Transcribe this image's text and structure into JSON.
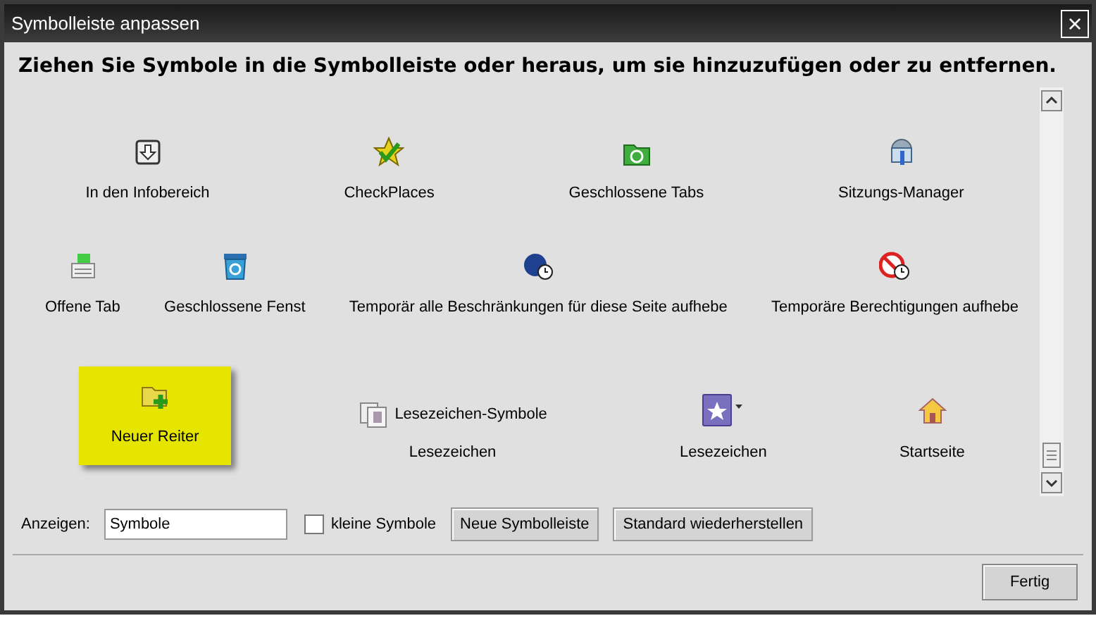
{
  "window": {
    "title": "Symbolleiste anpassen",
    "close": "×"
  },
  "instruction": "Ziehen Sie Symbole in die Symbolleiste oder heraus, um sie hinzuzufügen oder zu entfernen.",
  "rows": [
    [
      {
        "label": "In den Infobereich",
        "kind": "stacked",
        "selected": false
      },
      {
        "label": "CheckPlaces",
        "kind": "stacked",
        "selected": false
      },
      {
        "label": "Geschlossene Tabs",
        "kind": "stacked",
        "selected": false
      },
      {
        "label": "Sitzungs-Manager",
        "kind": "stacked",
        "selected": false
      }
    ],
    [
      {
        "label": "Offene Tab",
        "kind": "stacked",
        "selected": false
      },
      {
        "label": "Geschlossene Fenst",
        "kind": "stacked",
        "selected": false
      },
      {
        "label": "Temporär alle Beschränkungen für diese Seite aufhebe",
        "kind": "stacked",
        "selected": false
      },
      {
        "label": "Temporäre Berechtigungen aufhebe",
        "kind": "stacked",
        "selected": false
      }
    ],
    [
      {
        "label": "Neuer Reiter",
        "kind": "stacked",
        "selected": true
      },
      {
        "label": "Lesezeichen",
        "kind": "inline",
        "inline_label": "Lesezeichen-Symbole",
        "selected": false
      },
      {
        "label": "Lesezeichen",
        "kind": "menu",
        "selected": false
      },
      {
        "label": "Startseite",
        "kind": "stacked",
        "selected": false
      }
    ]
  ],
  "show_label": "Anzeigen:",
  "show_field": {
    "value": "Symbole"
  },
  "small_icons": {
    "label": "kleine Symbole",
    "checked": false
  },
  "buttons": [
    "Neue Symbolleiste",
    "Standard wiederherstellen"
  ],
  "done_button": "Fertig"
}
